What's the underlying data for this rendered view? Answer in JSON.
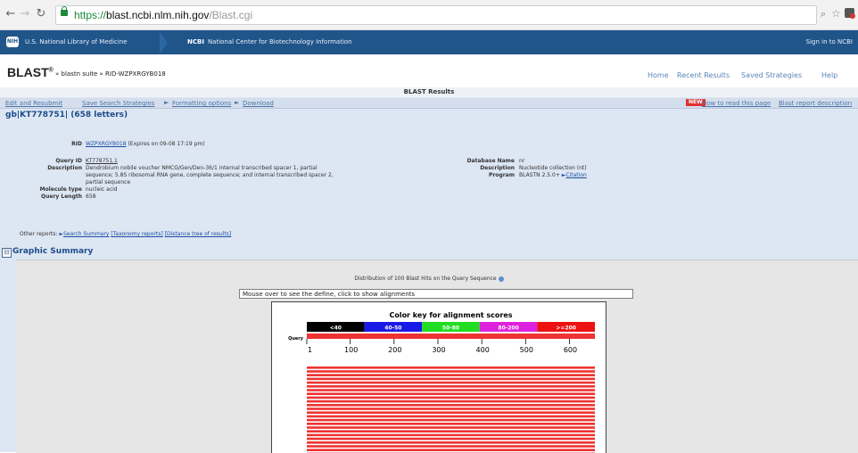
{
  "browser": {
    "url_proto": "https://",
    "url_host": "blast.ncbi.nlm.nih.gov",
    "url_path": "/Blast.cgi"
  },
  "ncbi_bar": {
    "nih_logo": "NIH",
    "nlm": "U.S. National Library of Medicine",
    "ncbi_abbr": "NCBI",
    "ncbi_name": "National Center for Biotechnology Information",
    "sign_in": "Sign in to NCBI"
  },
  "blast_header": {
    "title": "BLAST",
    "breadcrumb": "» blastn suite » RID-WZPXRGYB018",
    "nav": [
      "Home",
      "Recent Results",
      "Saved Strategies",
      "Help"
    ]
  },
  "results_title": "BLAST Results",
  "toolbar": {
    "edit": "Edit and Resubmit",
    "save": "Save Search Strategies",
    "formatting": "Formatting options",
    "download": "Download",
    "badge": "NEW",
    "howto": "How to read this page",
    "report": "Blast report description"
  },
  "sequence_id": "gb|KT778751| (658 letters)",
  "query_info": {
    "rid_label": "RID",
    "rid_value": "WZPXRGYB018",
    "rid_expires": "(Expires on 09-08 17:19 pm)",
    "query_id_label": "Query ID",
    "query_id_value": "KT778751.1",
    "description_label": "Description",
    "description_lines": [
      "Dendrobium nobile voucher NMCG/Gen/Den-36/1 internal transcribed spacer 1, partial",
      "sequence; 5.8S ribosomal RNA gene, complete sequence; and internal transcribed spacer 2,",
      "partial sequence"
    ],
    "molecule_label": "Molecule type",
    "molecule_value": "nucleic acid",
    "length_label": "Query Length",
    "length_value": "658",
    "db_label": "Database Name",
    "db_value": "nr",
    "db_desc_label": "Description",
    "db_desc_value": "Nucleotide collection (nt)",
    "program_label": "Program",
    "program_value": "BLASTN 2.5.0+",
    "citation": "Citation"
  },
  "other_reports": {
    "label": "Other reports:",
    "search_summary": "Search Summary",
    "taxonomy": "[Taxonomy reports]",
    "distance_tree": "[Distance tree of results]"
  },
  "graphic_summary": {
    "toggle": "⊟",
    "title": "Graphic Summary",
    "distribution": "Distribution of 100 Blast Hits on the Query Sequence",
    "mouseover": "Mouse over to see the define, click to show alignments",
    "color_key_title": "Color key for alignment scores",
    "color_key": [
      {
        "label": "<40",
        "color": "#000000"
      },
      {
        "label": "40-50",
        "color": "#1a1ae6"
      },
      {
        "label": "50-80",
        "color": "#22dd22"
      },
      {
        "label": "80-200",
        "color": "#dd22dd"
      },
      {
        "label": ">=200",
        "color": "#ee1111"
      }
    ],
    "query_label": "Query",
    "ruler_ticks": [
      "1",
      "100",
      "200",
      "300",
      "400",
      "500",
      "600"
    ],
    "hit_color": "#ee3333"
  }
}
